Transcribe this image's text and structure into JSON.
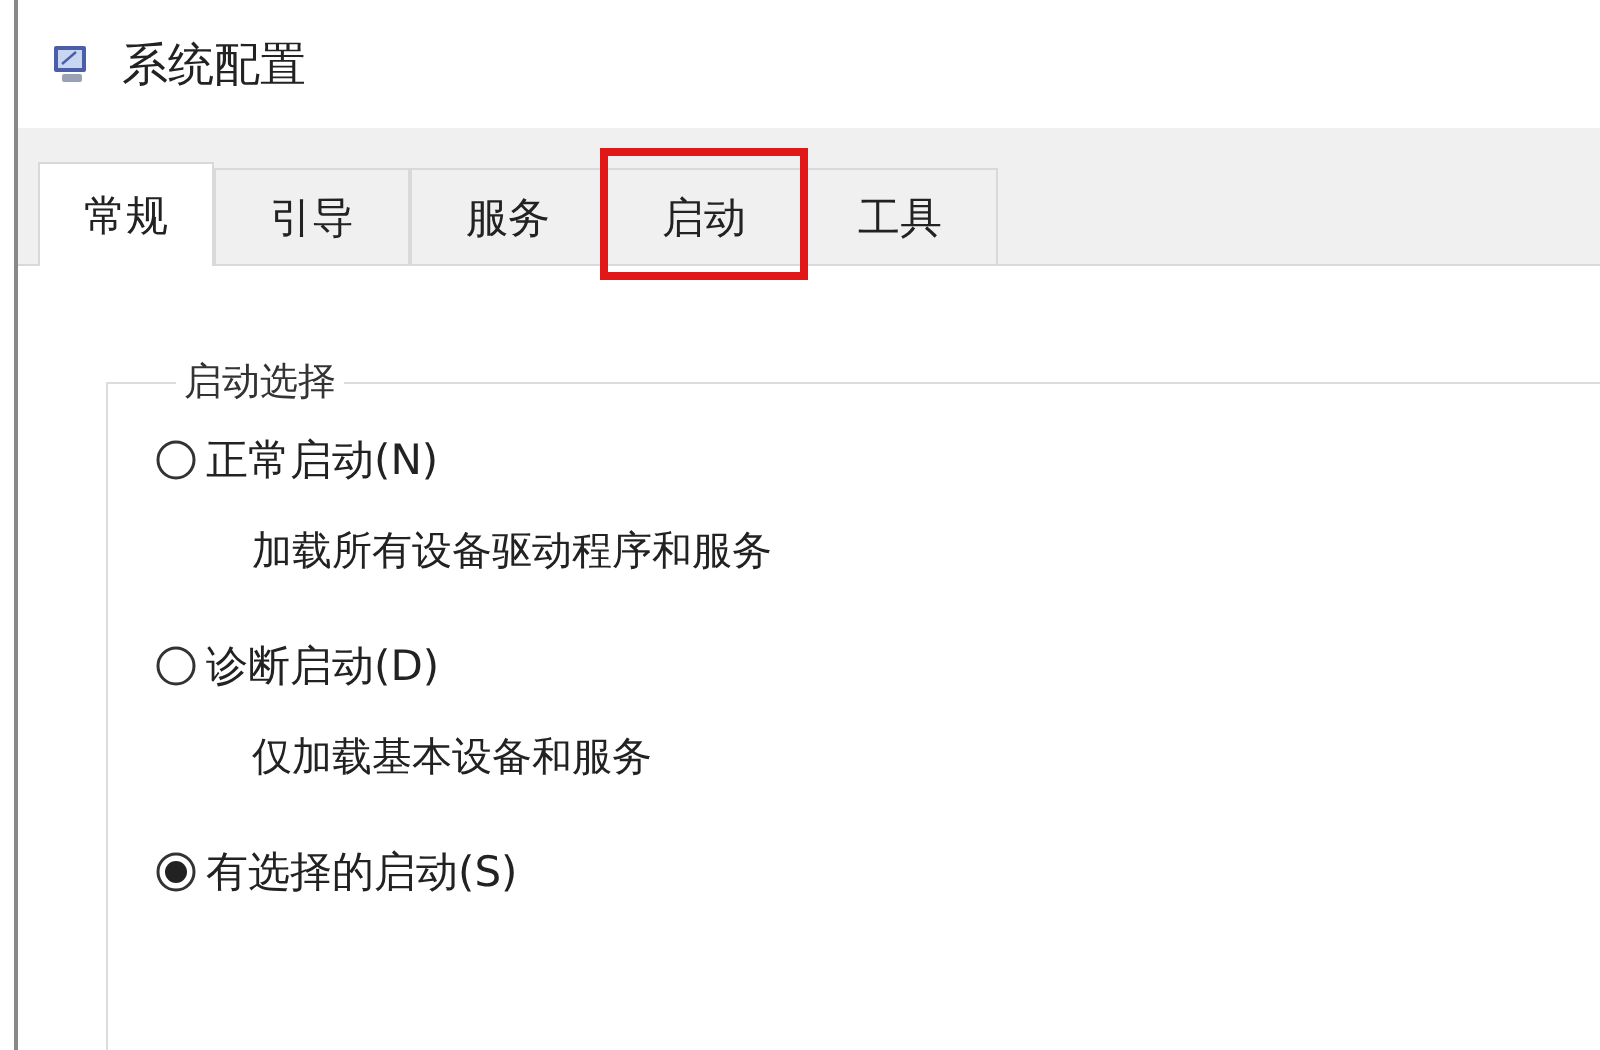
{
  "window": {
    "title": "系统配置"
  },
  "tabs": [
    {
      "label": "常规",
      "selected": true,
      "highlighted": false
    },
    {
      "label": "引导",
      "selected": false,
      "highlighted": false
    },
    {
      "label": "服务",
      "selected": false,
      "highlighted": false
    },
    {
      "label": "启动",
      "selected": false,
      "highlighted": true
    },
    {
      "label": "工具",
      "selected": false,
      "highlighted": false
    }
  ],
  "startup_selection": {
    "title": "启动选择",
    "options": [
      {
        "label": "正常启动(N)",
        "selected": false,
        "description": "加载所有设备驱动程序和服务"
      },
      {
        "label": "诊断启动(D)",
        "selected": false,
        "description": "仅加载基本设备和服务"
      },
      {
        "label": "有选择的启动(S)",
        "selected": true
      }
    ]
  }
}
